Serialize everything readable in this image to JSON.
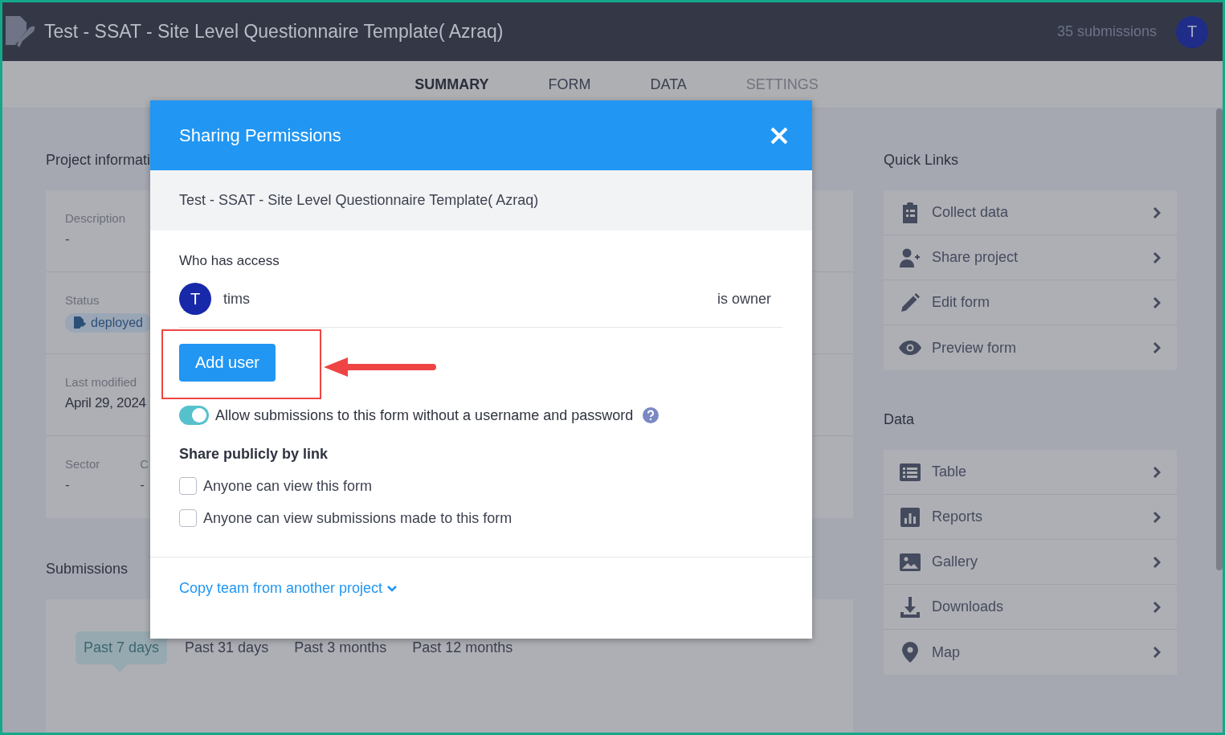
{
  "header": {
    "title": "Test - SSAT - Site Level Questionnaire Template( Azraq)",
    "submission_count": "35 submissions",
    "avatar": "T"
  },
  "tabs": [
    {
      "label": "SUMMARY",
      "selected": true,
      "disabled": false
    },
    {
      "label": "FORM",
      "selected": false,
      "disabled": false
    },
    {
      "label": "DATA",
      "selected": false,
      "disabled": false
    },
    {
      "label": "SETTINGS",
      "selected": false,
      "disabled": true
    }
  ],
  "project_info": {
    "heading": "Project informati",
    "rows": [
      {
        "kind": "text",
        "label": "Description",
        "value": "-"
      },
      {
        "kind": "badge",
        "label": "Status",
        "value": "deployed"
      },
      {
        "kind": "date",
        "label": "Last modified",
        "value": "April 29, 2024"
      },
      {
        "kind": "columns",
        "columns": [
          {
            "label": "Sector",
            "value": "-"
          },
          {
            "label": "C",
            "value": "-"
          }
        ]
      }
    ]
  },
  "submissions": {
    "heading": "Submissions",
    "periods": [
      {
        "label": "Past 7 days",
        "selected": true
      },
      {
        "label": "Past 31 days",
        "selected": false
      },
      {
        "label": "Past 3 months",
        "selected": false
      },
      {
        "label": "Past 12 months",
        "selected": false
      }
    ]
  },
  "quick_links": {
    "heading": "Quick Links",
    "items": [
      {
        "label": "Collect data"
      },
      {
        "label": "Share project"
      },
      {
        "label": "Edit form"
      },
      {
        "label": "Preview form"
      }
    ]
  },
  "data_links": {
    "heading": "Data",
    "items": [
      {
        "label": "Table"
      },
      {
        "label": "Reports"
      },
      {
        "label": "Gallery"
      },
      {
        "label": "Downloads"
      },
      {
        "label": "Map"
      }
    ]
  },
  "dialog": {
    "title": "Sharing Permissions",
    "project_name": "Test - SSAT - Site Level Questionnaire Template( Azraq)",
    "access_heading": "Who has access",
    "users": [
      {
        "initial": "T",
        "name": "tims",
        "role": "is owner"
      }
    ],
    "add_button": "Add user",
    "anonymous_toggle": {
      "label": "Allow submissions to this form without a username and password",
      "on": true
    },
    "public_heading": "Share publicly by link",
    "public_options": [
      {
        "label": "Anyone can view this form",
        "checked": false
      },
      {
        "label": "Anyone can view submissions made to this form",
        "checked": false
      }
    ],
    "copy_team": "Copy team from another project"
  }
}
